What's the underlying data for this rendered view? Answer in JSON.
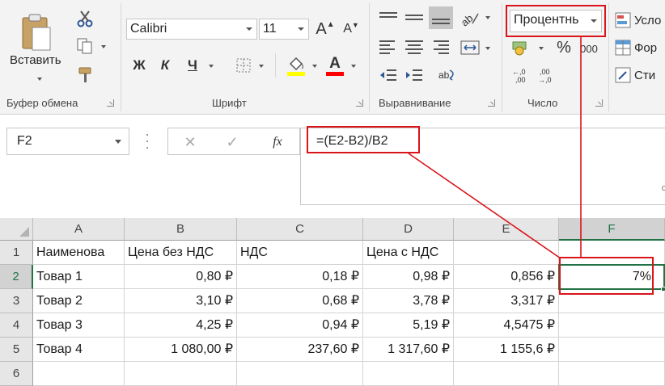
{
  "ribbon": {
    "clipboard": {
      "paste_label": "Вставить",
      "group_label": "Буфер обмена"
    },
    "font": {
      "font_name": "Calibri",
      "font_size": "11",
      "bold": "Ж",
      "italic": "К",
      "underline": "Ч",
      "grow": "A",
      "shrink": "A",
      "font_color_glyph": "A",
      "group_label": "Шрифт"
    },
    "alignment": {
      "group_label": "Выравнивание"
    },
    "number": {
      "format_value": "Процентнь",
      "percent": "%",
      "thousands": "000",
      "group_label": "Число"
    },
    "styles": {
      "conditional": "Усло",
      "format_table": "Фор",
      "cell_styles": "Сти"
    }
  },
  "formula_bar": {
    "name_box": "F2",
    "cancel": "✕",
    "enter": "✓",
    "fx": "fx",
    "formula": "=(E2-B2)/B2"
  },
  "grid": {
    "columns": [
      "A",
      "B",
      "C",
      "D",
      "E",
      "F"
    ],
    "rows": [
      {
        "num": "1",
        "cells": [
          "Наименова",
          "Цена без НДС",
          "НДС",
          "Цена с НДС",
          "",
          ""
        ]
      },
      {
        "num": "2",
        "cells": [
          "Товар 1",
          "0,80 ₽",
          "0,18 ₽",
          "0,98 ₽",
          "0,856 ₽",
          "7%"
        ]
      },
      {
        "num": "3",
        "cells": [
          "Товар 2",
          "3,10 ₽",
          "0,68 ₽",
          "3,78 ₽",
          "3,317 ₽",
          ""
        ]
      },
      {
        "num": "4",
        "cells": [
          "Товар 3",
          "4,25 ₽",
          "0,94 ₽",
          "5,19 ₽",
          "4,5475 ₽",
          ""
        ]
      },
      {
        "num": "5",
        "cells": [
          "Товар 4",
          "1 080,00 ₽",
          "237,60 ₽",
          "1 317,60 ₽",
          "1 155,6 ₽",
          ""
        ]
      },
      {
        "num": "6",
        "cells": [
          "",
          "",
          "",
          "",
          "",
          ""
        ]
      }
    ]
  },
  "colors": {
    "highlight": "#d9141b",
    "ribbon_bg": "#f3f3f3",
    "header_bg": "#e6e6e6",
    "fill_yellow": "#ffff00",
    "font_red": "#ff0000"
  }
}
